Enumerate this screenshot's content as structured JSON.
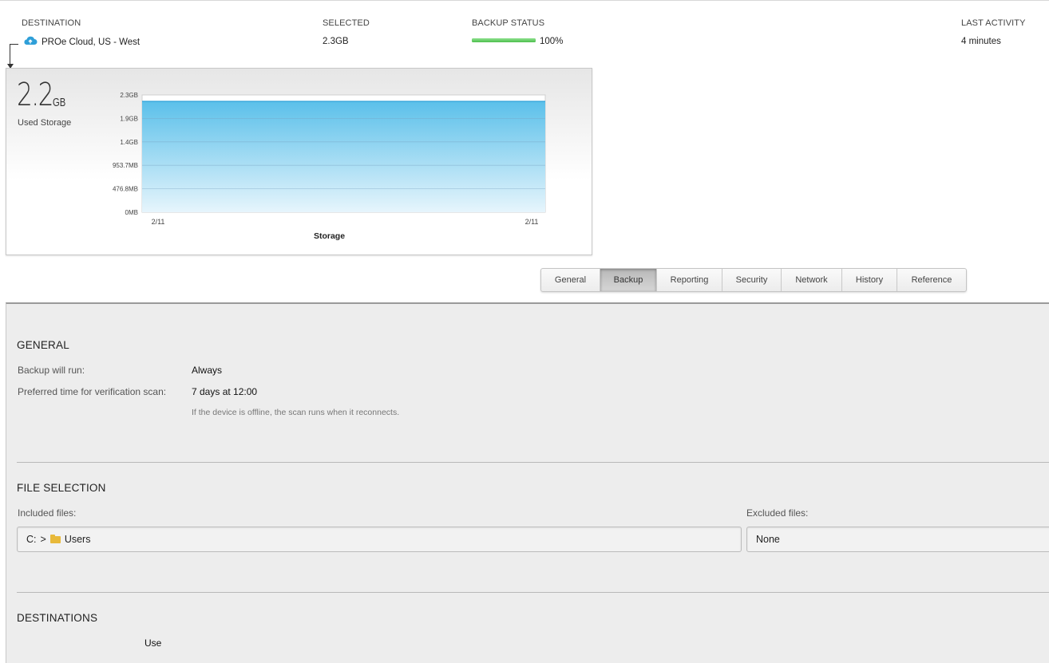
{
  "header": {
    "destination_label": "DESTINATION",
    "selected_label": "SELECTED",
    "backup_status_label": "BACKUP STATUS",
    "last_activity_label": "LAST ACTIVITY"
  },
  "row": {
    "destination": "PROe Cloud, US - West",
    "destination_icon": "cloud-upload-icon",
    "selected": "2.3GB",
    "backup_progress": 1.0,
    "backup_status": "100%",
    "last_activity": "4 minutes"
  },
  "storage": {
    "used_value": "2.2",
    "used_unit": "GB",
    "used_label": "Used Storage"
  },
  "chart_data": {
    "type": "area",
    "title": "",
    "xlabel": "Storage",
    "ylabel": "",
    "y_ticks": [
      "0MB",
      "476.8MB",
      "953.7MB",
      "1.4GB",
      "1.9GB",
      "2.3GB"
    ],
    "y_tick_values_gb": [
      0,
      0.4656,
      0.9313,
      1.3969,
      1.8626,
      2.3283
    ],
    "x_ticks": [
      "2/11",
      "2/11"
    ],
    "ylim_gb": [
      0,
      2.3283
    ],
    "series": [
      {
        "x": [
          "2/11",
          "2/11"
        ],
        "values_gb": [
          2.2,
          2.2
        ]
      }
    ],
    "color": "#5bc0ea",
    "grid": true
  },
  "tabs": [
    {
      "label": "General",
      "active": false
    },
    {
      "label": "Backup",
      "active": true
    },
    {
      "label": "Reporting",
      "active": false
    },
    {
      "label": "Security",
      "active": false
    },
    {
      "label": "Network",
      "active": false
    },
    {
      "label": "History",
      "active": false
    },
    {
      "label": "Reference",
      "active": false
    }
  ],
  "general": {
    "title": "GENERAL",
    "backup_run_label": "Backup will run:",
    "backup_run_value": "Always",
    "verify_label": "Preferred time for verification scan:",
    "verify_value": "7 days at 12:00",
    "verify_note": "If the device is offline, the scan runs when it reconnects."
  },
  "file_selection": {
    "title": "FILE SELECTION",
    "included_label": "Included files:",
    "included_drive": "C:",
    "included_separator": ">",
    "included_folder": "Users",
    "excluded_label": "Excluded files:",
    "excluded_value": "None"
  },
  "destinations": {
    "title": "DESTINATIONS",
    "use_label": "Use"
  }
}
